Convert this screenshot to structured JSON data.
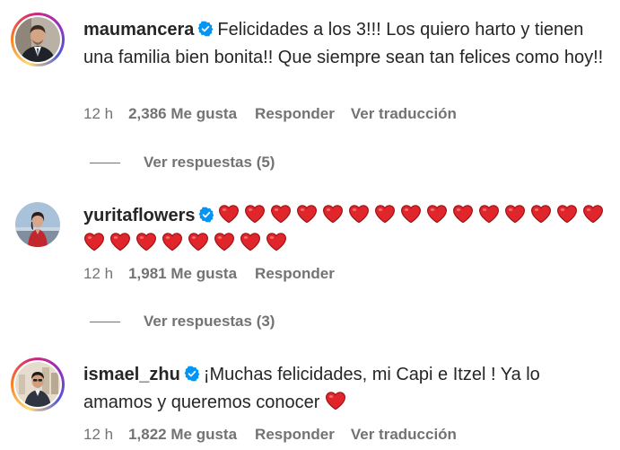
{
  "comments": [
    {
      "username": "maumancera",
      "verified": true,
      "text": "Felicidades a los 3!!! Los quiero harto y tienen una familia bien bonita!! Que siempre sean tan felices como hoy!!",
      "time": "12 h",
      "likes": "2,386 Me gusta",
      "reply_label": "Responder",
      "translate_label": "Ver traducción",
      "view_replies": "Ver respuestas (5)",
      "avatar_icon": "profile-photo-man-suit",
      "story_ring": true
    },
    {
      "username": "yuritaflowers",
      "verified": true,
      "text": "❤️❤️❤️❤️❤️❤️❤️❤️❤️❤️❤️❤️❤️❤️❤️❤️❤️❤️❤️❤️❤️❤️❤️",
      "heart_count": 23,
      "time": "12 h",
      "likes": "1,981 Me gusta",
      "reply_label": "Responder",
      "view_replies": "Ver respuestas (3)",
      "avatar_icon": "profile-photo-woman-red-dress",
      "story_ring": false
    },
    {
      "username": "ismael_zhu",
      "verified": true,
      "text": "¡Muchas felicidades, mi Capi e Itzel ! Ya lo amamos y queremos conocer",
      "trailing_emoji": "❤️",
      "time": "12 h",
      "likes": "1,822 Me gusta",
      "reply_label": "Responder",
      "translate_label": "Ver traducción",
      "avatar_icon": "profile-photo-man-city",
      "story_ring": true
    }
  ],
  "colors": {
    "text": "#262626",
    "secondary": "#737373",
    "verified": "#0095f6",
    "heart": "#e0262b"
  }
}
